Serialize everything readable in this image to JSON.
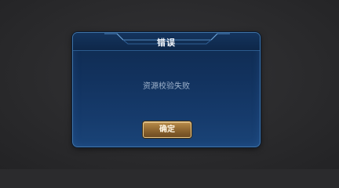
{
  "dialog": {
    "title": "错误",
    "message": "资源校验失败",
    "confirm_label": "确定"
  },
  "colors": {
    "background": "#2b2b2d",
    "dialog_border": "#3f74a8",
    "dialog_fill": "#163b6c",
    "button_gold": "#b98c4a",
    "message_text": "#9fb3cc"
  }
}
